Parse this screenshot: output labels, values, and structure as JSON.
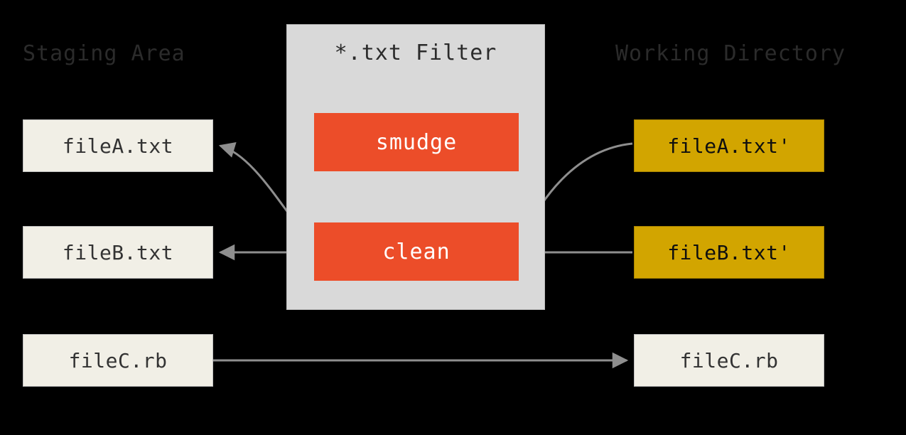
{
  "headings": {
    "staging": "Staging Area",
    "filter": "*.txt Filter",
    "working": "Working Directory"
  },
  "filter": {
    "smudge": "smudge",
    "clean": "clean"
  },
  "staging_files": {
    "a": "fileA.txt",
    "b": "fileB.txt",
    "c": "fileC.rb"
  },
  "working_files": {
    "a": "fileA.txt'",
    "b": "fileB.txt'",
    "c": "fileC.rb"
  },
  "colors": {
    "bg_beige": "#f1efe6",
    "bg_mustard": "#d2a500",
    "bg_filter": "#d9d9d9",
    "bg_cell": "#ec4d29",
    "arrow": "#8e8e8e"
  }
}
